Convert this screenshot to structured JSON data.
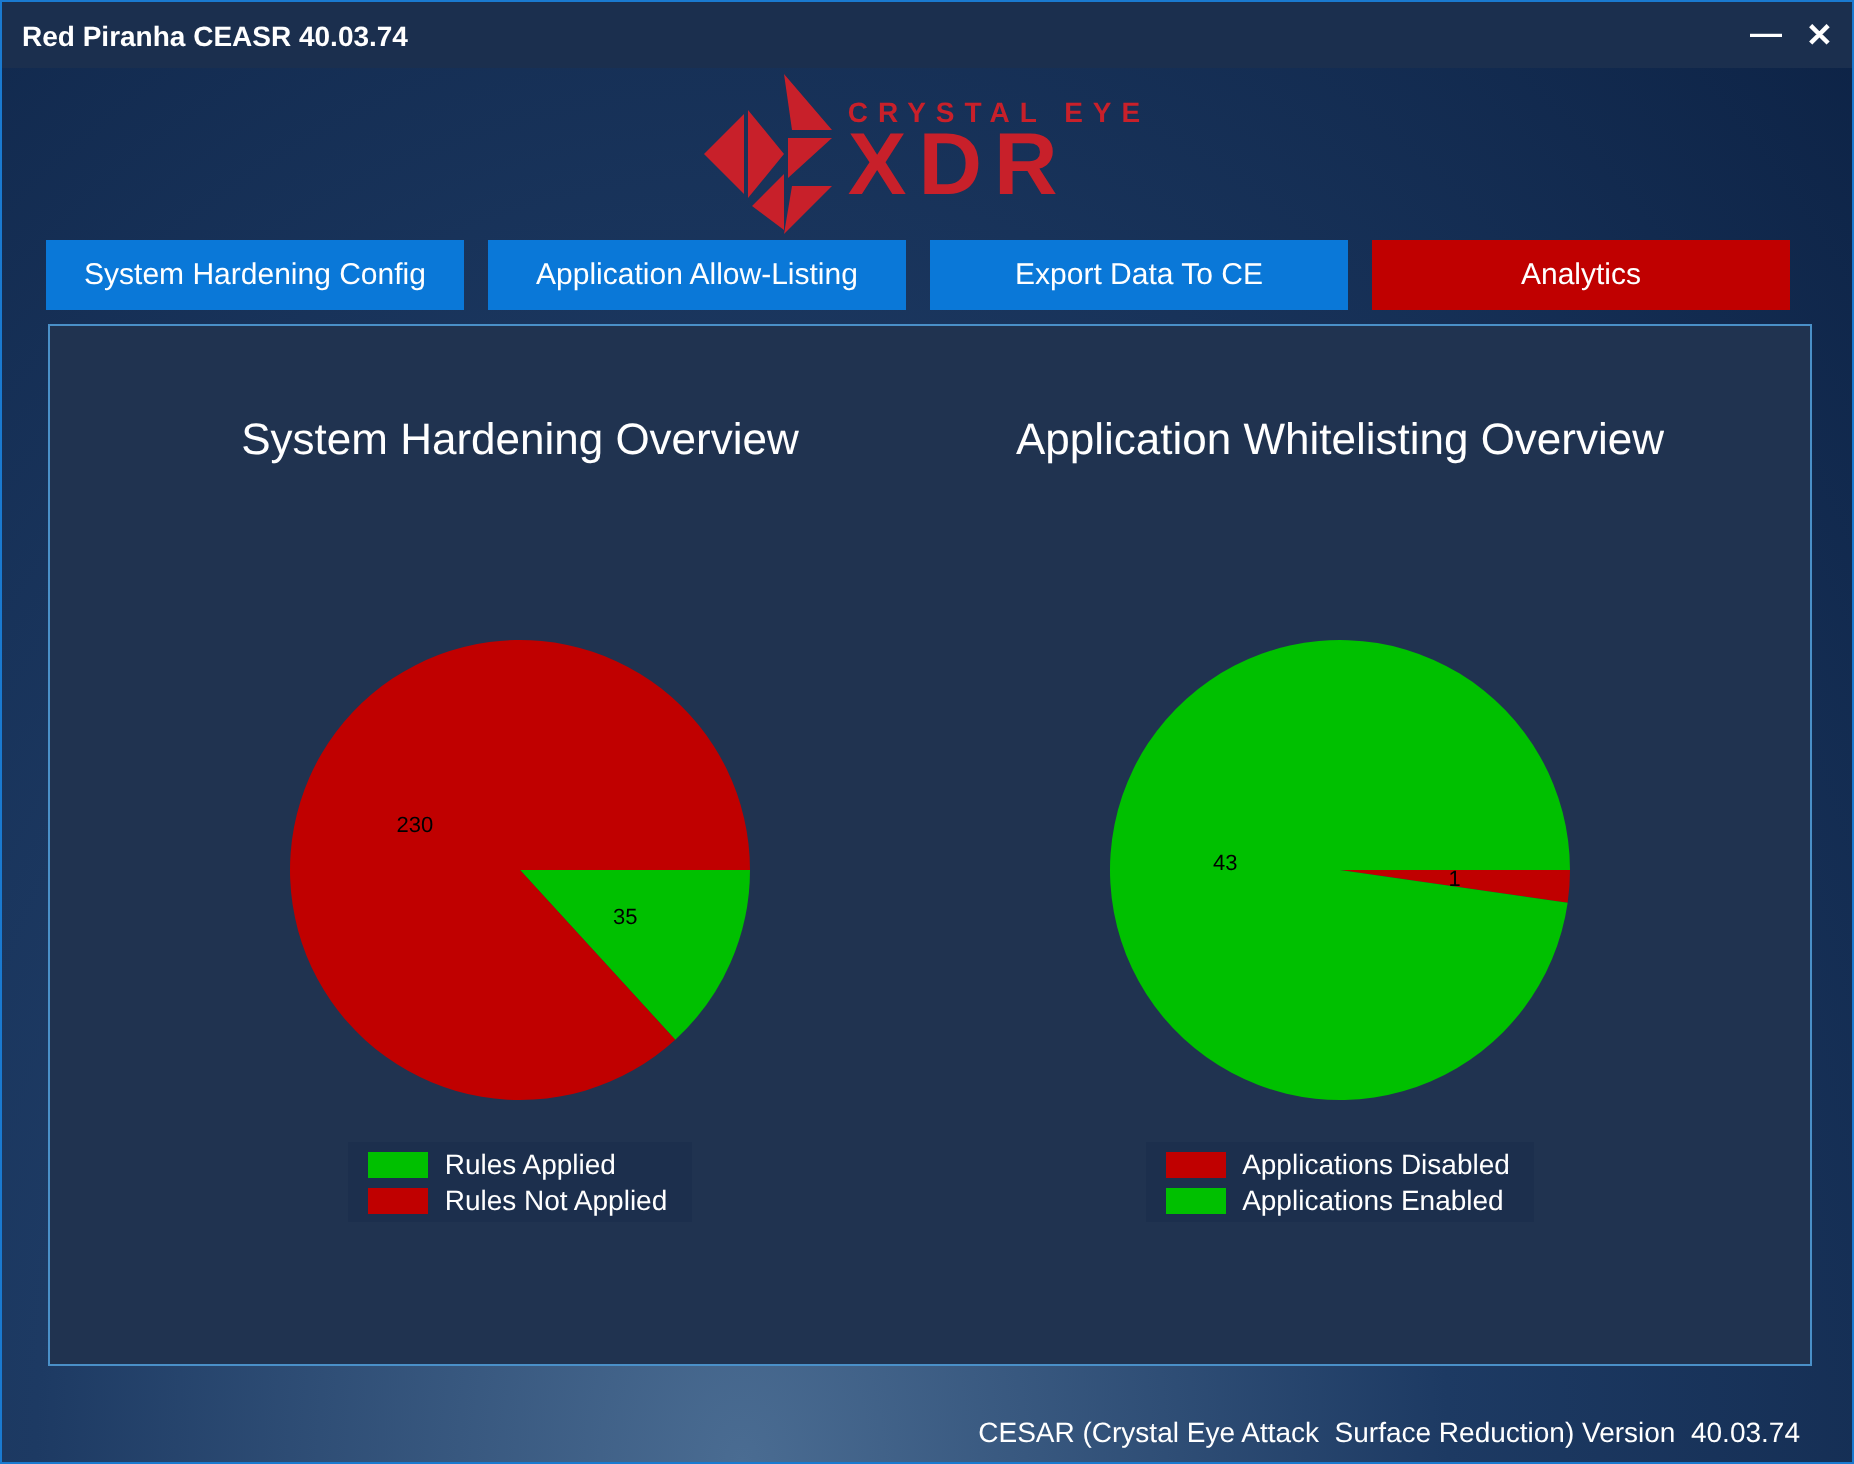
{
  "window": {
    "title": "Red Piranha CEASR 40.03.74",
    "controls": [
      "—",
      "✕"
    ]
  },
  "logo": {
    "top": "CRYSTAL EYE",
    "bottom": "XDR"
  },
  "tabs": [
    {
      "label": "System Hardening Config",
      "selected": false
    },
    {
      "label": "Application Allow-Listing",
      "selected": false
    },
    {
      "label": "Export Data To CE",
      "selected": false
    },
    {
      "label": "Analytics",
      "selected": true
    }
  ],
  "charts": [
    {
      "title": "System Hardening Overview",
      "legend": [
        {
          "color": "#00c000"
        },
        {
          "color": "#c00000"
        }
      ],
      "chart_data": {
        "type": "pie",
        "data_labels": true,
        "categories": [
          "Rules Applied",
          "Rules Not Applied"
        ],
        "values": [
          35,
          230
        ]
      }
    },
    {
      "title": "Application Whitelisting Overview",
      "legend": [
        {
          "color": "#c00000"
        },
        {
          "color": "#00c000"
        }
      ],
      "chart_data": {
        "type": "pie",
        "data_labels": true,
        "categories": [
          "Applications Disabled",
          "Applications Enabled"
        ],
        "values": [
          1,
          43
        ]
      }
    }
  ],
  "status_bar": "CESAR (Crystal Eye Attack  Surface Reduction) Version  40.03.74"
}
